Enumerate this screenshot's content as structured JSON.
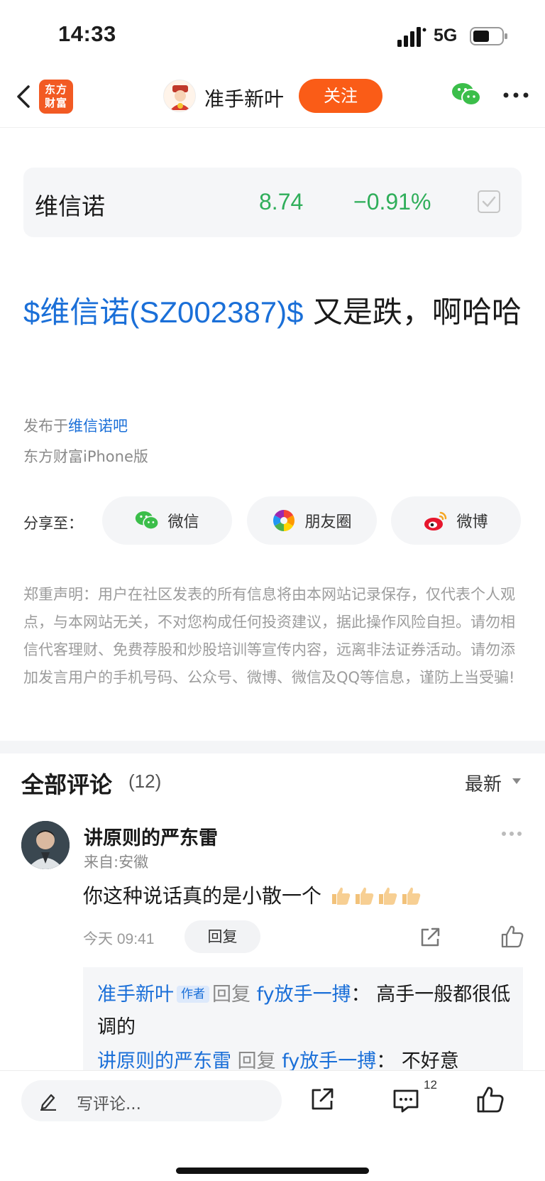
{
  "status_bar": {
    "time": "14:33",
    "network": "5G"
  },
  "nav": {
    "brand_logo_line1": "东方",
    "brand_logo_line2": "财富",
    "author_name": "准手新叶",
    "follow_label": "关注"
  },
  "cut_text": "证券",
  "stock_card": {
    "name": "维信诺",
    "price": "8.74",
    "change": "−0.91%"
  },
  "post": {
    "title_stock": "$维信诺(SZ002387)$",
    "title_text": " 又是跌，啊哈哈",
    "published_prefix": "发布于",
    "published_forum": "维信诺吧",
    "device": "东方财富iPhone版"
  },
  "share": {
    "label": "分享至：",
    "wechat": "微信",
    "moments": "朋友圈",
    "weibo": "微博"
  },
  "disclaimer": "郑重声明：用户在社区发表的所有信息将由本网站记录保存，仅代表个人观点，与本网站无关，不对您构成任何投资建议，据此操作风险自担。请勿相信代客理财、免费荐股和炒股培训等宣传内容，远离非法证券活动。请勿添加发言用户的手机号码、公众号、微博、微信及QQ等信息，谨防上当受骗!",
  "comments": {
    "heading": "全部评论",
    "count": "(12)",
    "sort_label": "最新",
    "items": [
      {
        "name": "讲原则的严东雷",
        "from": "来自:安徽",
        "text": "你这种说话真的是小散一个",
        "time": "今天 09:41",
        "reply_label": "回复",
        "replies": [
          {
            "author": "准手新叶",
            "tag": "作者",
            "verb": "回复",
            "target": "fy放手一搏",
            "sep": "：",
            "text": "高手一般都很低调的"
          },
          {
            "author": "讲原则的严东雷",
            "tag": "",
            "verb": "回复",
            "target": "fy放手一搏",
            "sep": "：",
            "text": "不好意"
          }
        ]
      }
    ]
  },
  "bottom_bar": {
    "placeholder": "写评论...",
    "comment_count": "12"
  },
  "colors": {
    "accent_orange": "#fa5c17",
    "link_blue": "#1a6fd8",
    "stock_green": "#2fae5a"
  },
  "icons": [
    "back-icon",
    "wechat-icon",
    "more-icon",
    "checkbox-icon",
    "moments-icon",
    "weibo-icon",
    "pen-icon",
    "share-icon",
    "comment-icon",
    "thumb-up-icon"
  ]
}
